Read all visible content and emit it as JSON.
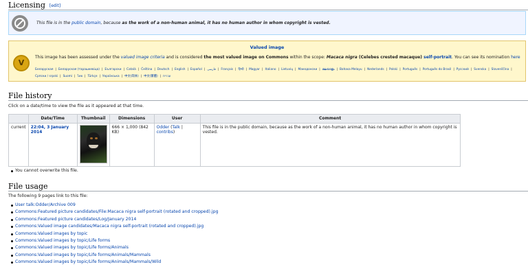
{
  "licensing": {
    "heading": "Licensing",
    "edit": "[edit]",
    "pd_pre": "This file is in the ",
    "pd_link": "public domain",
    "pd_mid": ", because ",
    "pd_bold": "as the work of a non-human animal, it has no human author in whom copyright is vested."
  },
  "valued": {
    "title": "Valued image",
    "t1": "This image has been assessed under the ",
    "t2": "valued image criteria",
    "t3": " and is considered ",
    "t4": "the most valued image on Commons",
    "t5": " within the scope: ",
    "t6": "Macaca nigra",
    "t7": " (Celebes crested macaque) ",
    "t8": "self-portrait",
    "t9": ". You can see its nomination ",
    "t10": "here",
    "languages": [
      "Беларуская",
      "Беларуская (тарашкевіца)",
      "Български",
      "Català",
      "Čeština",
      "Deutsch",
      "English",
      "Español",
      "فارسی",
      "Français",
      "हिन्दी",
      "Magyar",
      "Italiano",
      "Lietuvių",
      "Македонски",
      "മലയാളം",
      "Bahasa Melayu",
      "Nederlands",
      "Polski",
      "Português",
      "Português do Brasil",
      "Русский",
      "Svenska",
      "Slovenščina",
      "Српски / srpski",
      "Suomi",
      "ไทย",
      "Türkçe",
      "Українська",
      "中文(简体)",
      "中文(繁體)",
      "עברית"
    ]
  },
  "history": {
    "heading": "File history",
    "note": "Click on a date/time to view the file as it appeared at that time.",
    "columns": [
      "",
      "Date/Time",
      "Thumbnail",
      "Dimensions",
      "User",
      "Comment"
    ],
    "row": {
      "status": "current",
      "datetime": "22:04, 3 January 2014",
      "dimensions": "666 × 1,000 (842 KB)",
      "user": "Odder",
      "talk": "Talk",
      "contribs": "contribs",
      "comment": "This file is in the public domain, because as the work of a non-human animal, it has no human author in whom copyright is vested."
    },
    "overwrite": "You cannot overwrite this file."
  },
  "usage": {
    "heading": "File usage",
    "note": "The following 9 pages link to this file:",
    "links": [
      "User talk:Odder/Archive 009",
      "Commons:Featured picture candidates/File:Macaca nigra self-portrait (rotated and cropped).jpg",
      "Commons:Featured picture candidates/Log/January 2014",
      "Commons:Valued image candidates/Macaca nigra self-portrait (rotated and cropped).jpg",
      "Commons:Valued images by topic",
      "Commons:Valued images by topic/Life forms",
      "Commons:Valued images by topic/Life forms/Animals",
      "Commons:Valued images by topic/Life forms/Animals/Mammals",
      "Commons:Valued images by topic/Life forms/Animals/Mammals/Wild"
    ]
  }
}
